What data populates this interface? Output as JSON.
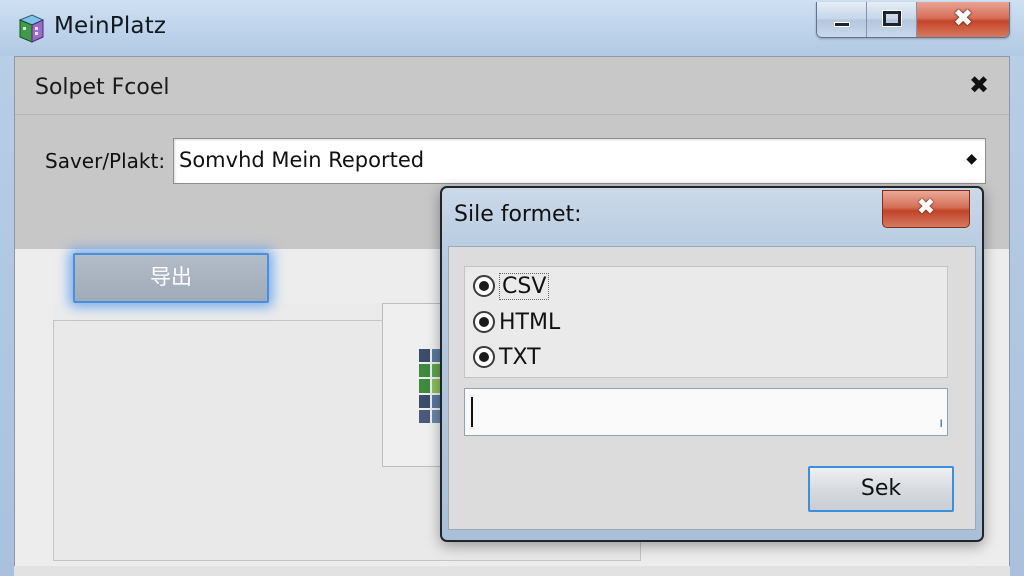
{
  "window": {
    "title": "MeinPlatz",
    "controls": {
      "minimize": "minimize",
      "maximize": "maximize",
      "close": "✖"
    }
  },
  "panel": {
    "title": "Solpet Fcoel",
    "close": "✖",
    "path_label": "Saver/Plakt:",
    "path_value": "Somvhd Mein Reported",
    "path_arrow": "◆",
    "export_label": "导出"
  },
  "dialog": {
    "title": "Sile formet:",
    "close": "✖",
    "options": [
      {
        "label": "CSV",
        "selected": true
      },
      {
        "label": "HTML",
        "selected": true
      },
      {
        "label": "TXT",
        "selected": true
      }
    ],
    "input_value": "",
    "resize_glyph": "ı",
    "ok_label": "Sek"
  },
  "colors": {
    "focus_glow": "#4d8fd6",
    "close_red": "#c6452a",
    "titlebar": "#bcd2ea"
  },
  "icons": {
    "app": "app-cube-icon",
    "minimize": "minimize-icon",
    "maximize": "maximize-icon",
    "close": "close-icon",
    "dropdown": "dropdown-arrow-icon",
    "thumbnail": "grid-thumbnail-icon"
  }
}
